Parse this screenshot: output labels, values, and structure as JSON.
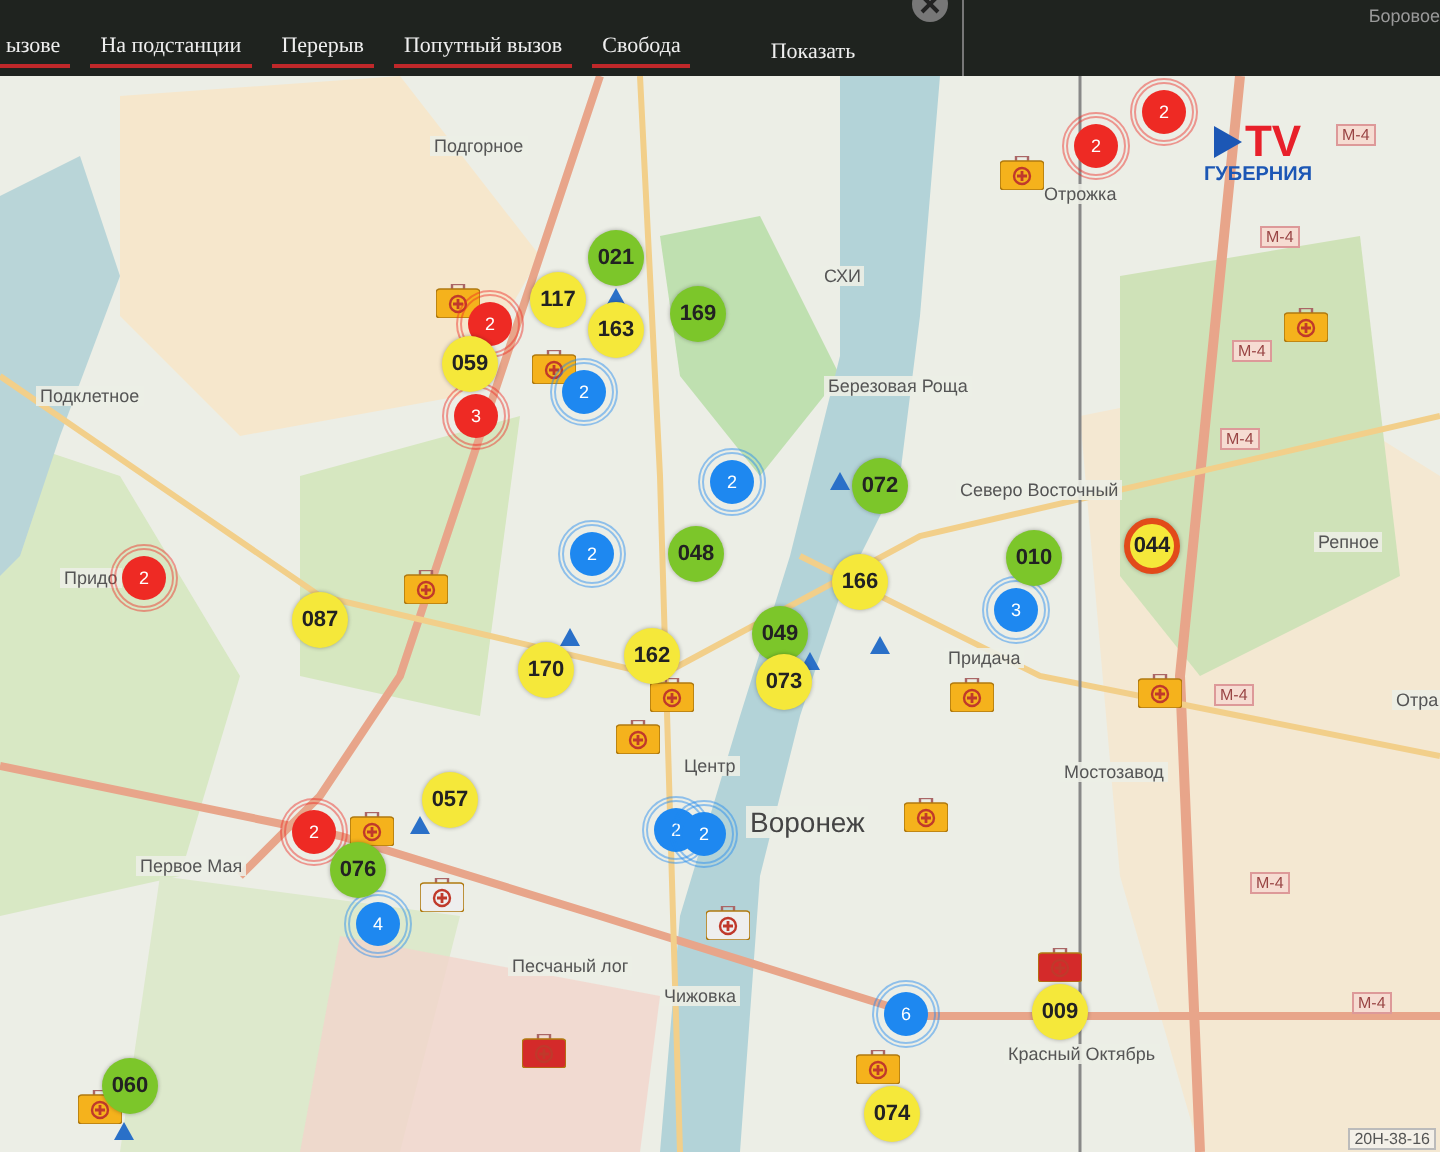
{
  "filters": [
    {
      "label": "ызове"
    },
    {
      "label": "На подстанции"
    },
    {
      "label": "Перерыв"
    },
    {
      "label": "Попутный вызов"
    },
    {
      "label": "Свобода"
    }
  ],
  "show_button": "Показать",
  "corner_label": "Боровое",
  "logo": {
    "mark": "TV",
    "name": "ГУБЕРНИЯ"
  },
  "places": [
    {
      "name": "Подгорное"
    },
    {
      "name": "Подклетное"
    },
    {
      "name": "Придо"
    },
    {
      "name": "СХИ"
    },
    {
      "name": "Березовая Роща"
    },
    {
      "name": "Северо Восточный"
    },
    {
      "name": "Репное"
    },
    {
      "name": "Отрожка"
    },
    {
      "name": "Центр"
    },
    {
      "name": "Воронеж"
    },
    {
      "name": "Первое Мая"
    },
    {
      "name": "Песчаный лог"
    },
    {
      "name": "Чижовка"
    },
    {
      "name": "Придача"
    },
    {
      "name": "Мостозавод"
    },
    {
      "name": "Красный Октябрь"
    },
    {
      "name": "Отра"
    }
  ],
  "road_signs": [
    "М-4",
    "М-4",
    "М-4",
    "М-4",
    "М-4",
    "М-4",
    "М-4"
  ],
  "road_code": "20Н-38-16",
  "stations": [
    {
      "color": "#f5b21c"
    },
    {
      "color": "#f5b21c"
    },
    {
      "color": "#f5b21c"
    },
    {
      "color": "#f5b21c"
    },
    {
      "color": "#f5b21c"
    },
    {
      "color": "#f5b21c"
    },
    {
      "color": "#f5b21c"
    },
    {
      "color": "#f5b21c"
    },
    {
      "color": "#f5b21c"
    },
    {
      "color": "#f5b21c"
    },
    {
      "color": "#f5b21c"
    },
    {
      "color": "#f5b21c"
    },
    {
      "color": "#f5b21c"
    },
    {
      "color": "#eeeeee"
    },
    {
      "color": "#eeeeee"
    },
    {
      "color": "#d42a2a"
    },
    {
      "color": "#d42a2a"
    }
  ],
  "clusters": [
    {
      "count": "2",
      "color": "#ee2a24"
    },
    {
      "count": "3",
      "color": "#ee2a24"
    },
    {
      "count": "2",
      "color": "#ee2a24"
    },
    {
      "count": "2",
      "color": "#ee2a24"
    },
    {
      "count": "2",
      "color": "#ee2a24"
    },
    {
      "count": "2",
      "color": "#ee2a24"
    },
    {
      "count": "2",
      "color": "#1e88f0"
    },
    {
      "count": "2",
      "color": "#1e88f0"
    },
    {
      "count": "2",
      "color": "#1e88f0"
    },
    {
      "count": "3",
      "color": "#1e88f0"
    },
    {
      "count": "2",
      "color": "#1e88f0"
    },
    {
      "count": "2",
      "color": "#1e88f0"
    },
    {
      "count": "4",
      "color": "#1e88f0"
    },
    {
      "count": "6",
      "color": "#1e88f0"
    }
  ],
  "units": [
    {
      "number": "021",
      "color": "#7cc62a",
      "alert": false
    },
    {
      "number": "117",
      "color": "#f5e83a",
      "alert": false
    },
    {
      "number": "163",
      "color": "#f5e83a",
      "alert": false
    },
    {
      "number": "169",
      "color": "#7cc62a",
      "alert": false
    },
    {
      "number": "059",
      "color": "#f5e83a",
      "alert": false
    },
    {
      "number": "072",
      "color": "#7cc62a",
      "alert": false
    },
    {
      "number": "048",
      "color": "#7cc62a",
      "alert": false
    },
    {
      "number": "010",
      "color": "#7cc62a",
      "alert": false
    },
    {
      "number": "044",
      "color": "#f5e83a",
      "alert": true
    },
    {
      "number": "166",
      "color": "#f5e83a",
      "alert": false
    },
    {
      "number": "087",
      "color": "#f5e83a",
      "alert": false
    },
    {
      "number": "170",
      "color": "#f5e83a",
      "alert": false
    },
    {
      "number": "162",
      "color": "#f5e83a",
      "alert": false
    },
    {
      "number": "049",
      "color": "#7cc62a",
      "alert": false
    },
    {
      "number": "073",
      "color": "#f5e83a",
      "alert": false
    },
    {
      "number": "057",
      "color": "#f5e83a",
      "alert": false
    },
    {
      "number": "076",
      "color": "#7cc62a",
      "alert": false
    },
    {
      "number": "009",
      "color": "#f5e83a",
      "alert": false
    },
    {
      "number": "060",
      "color": "#7cc62a",
      "alert": false
    },
    {
      "number": "074",
      "color": "#f5e83a",
      "alert": false
    }
  ]
}
